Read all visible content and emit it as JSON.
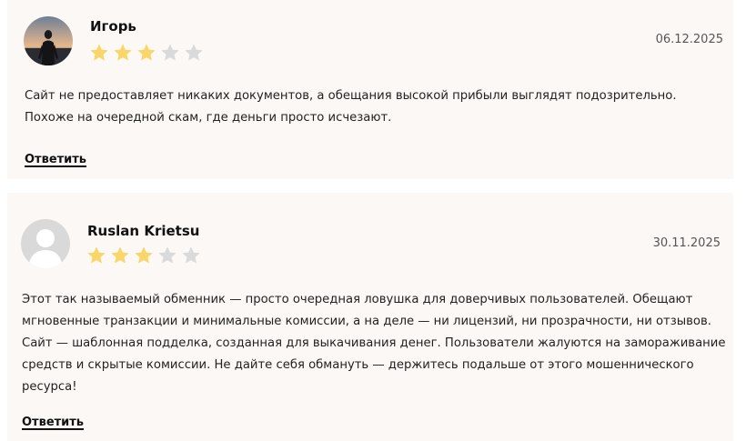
{
  "reviews": [
    {
      "author": "Игорь",
      "date": "06.12.2025",
      "rating": 3,
      "max_rating": 5,
      "avatar": "photo-avatar",
      "text": "Сайт не предоставляет никаких документов, а обещания высокой прибыли выглядят подозрительно. Похоже на очередной скам, где деньги просто исчезают.",
      "reply_label": "Ответить"
    },
    {
      "author": "Ruslan Krietsu",
      "date": "30.11.2025",
      "rating": 3,
      "max_rating": 5,
      "avatar": "default-user-avatar",
      "text": "Этот так называемый обменник — просто очередная ловушка для доверчивых пользователей. Обещают мгновенные транзакции и минимальные комиссии, а на деле — ни лицензий, ни прозрачности, ни отзывов. Сайт — шаблонная подделка, созданная для выкачивания денег. Пользователи жалуются на замораживание средств и скрытые комиссии. Не дайте себя обмануть — держитесь подальше от этого мошеннического ресурса!",
      "reply_label": "Ответить"
    }
  ],
  "colors": {
    "card_background": "#fcf8f5",
    "star_filled": "#f8d66a",
    "star_empty": "#dadada"
  }
}
